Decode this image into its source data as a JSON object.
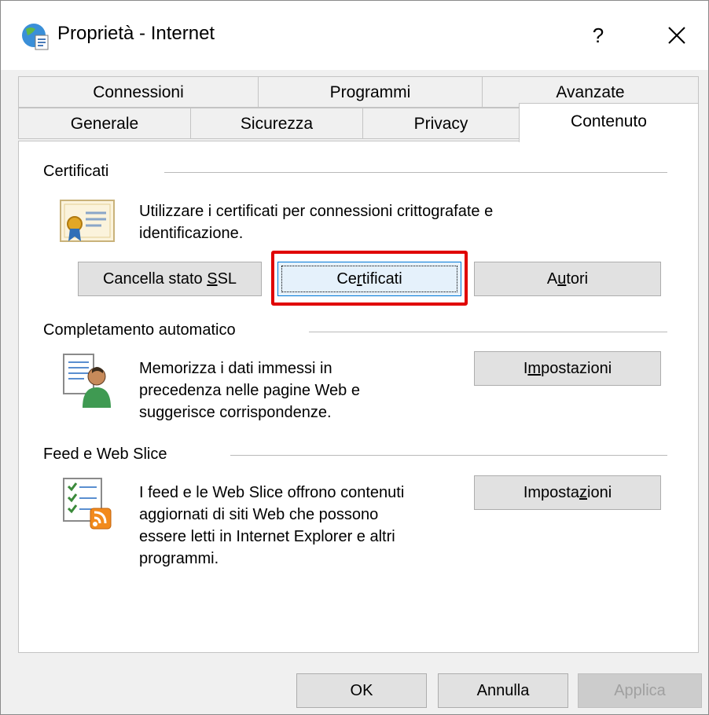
{
  "window": {
    "title": "Proprietà - Internet",
    "help_label": "?"
  },
  "tabs_row1": [
    {
      "label": "Connessioni"
    },
    {
      "label": "Programmi"
    },
    {
      "label": "Avanzate"
    }
  ],
  "tabs_row2": [
    {
      "label": "Generale"
    },
    {
      "label": "Sicurezza"
    },
    {
      "label": "Privacy"
    },
    {
      "label": "Contenuto",
      "active": true
    }
  ],
  "certificati": {
    "section_label": "Certificati",
    "description_line1": "Utilizzare i certificati per connessioni crittografate e",
    "description_line2": "identificazione.",
    "clear_ssl_button": {
      "before": "Cancella stato ",
      "accel": "S",
      "after": "SL"
    },
    "certificates_button": {
      "before": "Ce",
      "accel": "r",
      "after": "tificati"
    },
    "publishers_button": {
      "before": "A",
      "accel": "u",
      "after": "tori"
    }
  },
  "autocomplete": {
    "section_label": "Completamento automatico",
    "line1": "Memorizza i dati immessi in",
    "line2": "precedenza nelle pagine Web e",
    "line3": "suggerisce corrispondenze.",
    "settings_button": {
      "before": "I",
      "accel": "m",
      "after": "postazioni"
    }
  },
  "feeds": {
    "section_label": "Feed e Web Slice",
    "line1": "I feed e le Web Slice offrono contenuti",
    "line2": "aggiornati di siti Web che possono",
    "line3": "essere letti in Internet Explorer e altri",
    "line4": "programmi.",
    "settings_button": {
      "before": "Imposta",
      "accel": "z",
      "after": "ioni"
    }
  },
  "footer": {
    "ok_label": "OK",
    "cancel_label": "Annulla",
    "apply_label": "Applica"
  },
  "colors": {
    "highlight": "#e00000",
    "focus_border": "#0078d7"
  }
}
